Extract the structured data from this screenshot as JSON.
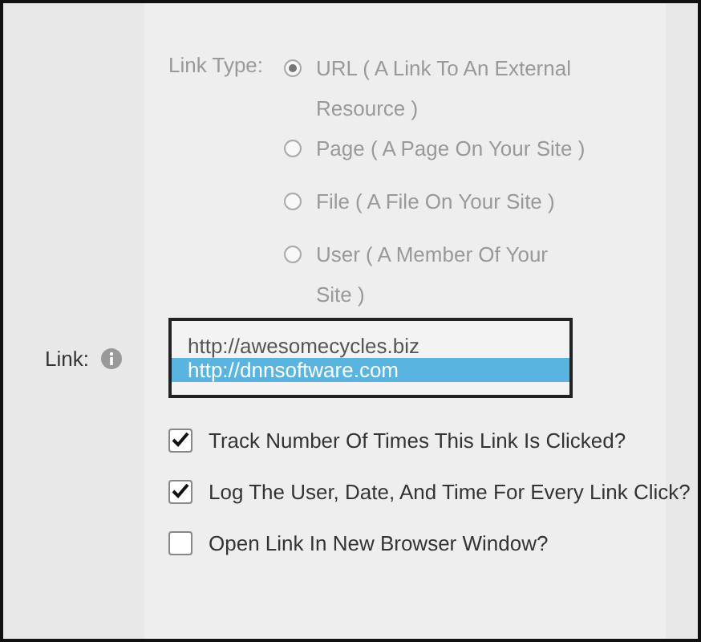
{
  "link_type": {
    "label": "Link Type:",
    "options": [
      {
        "label": "URL ( A Link To An External Resource )",
        "selected": true
      },
      {
        "label": "Page ( A Page On Your Site )",
        "selected": false
      },
      {
        "label": "File ( A File On Your Site )",
        "selected": false
      },
      {
        "label": "User ( A Member Of Your Site )",
        "selected": false
      }
    ]
  },
  "link": {
    "label": "Link:",
    "options": [
      {
        "label": "http://awesomecycles.biz",
        "selected": false
      },
      {
        "label": "http://dnnsoftware.com",
        "selected": true
      }
    ]
  },
  "checkboxes": [
    {
      "label": "Track Number Of Times This Link Is Clicked?",
      "checked": true
    },
    {
      "label": "Log The User, Date, And Time For Every Link Click?",
      "checked": true
    },
    {
      "label": "Open Link In New Browser Window?",
      "checked": false
    }
  ]
}
